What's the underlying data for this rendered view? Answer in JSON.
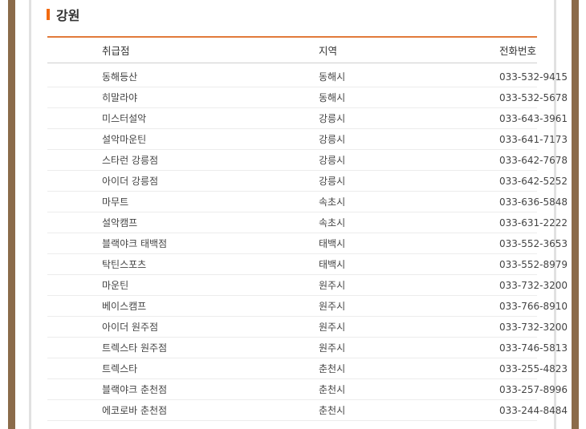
{
  "section": {
    "title": "강원"
  },
  "colors": {
    "accent": "#f26a10",
    "frame": "#8b6b4a"
  },
  "table": {
    "headers": {
      "store": "취급점",
      "region": "지역",
      "phone": "전화번호"
    },
    "rows": [
      {
        "store": "동해등산",
        "region": "동해시",
        "phone": "033-532-9415"
      },
      {
        "store": "히말라야",
        "region": "동해시",
        "phone": "033-532-5678"
      },
      {
        "store": "미스터설악",
        "region": "강릉시",
        "phone": "033-643-3961"
      },
      {
        "store": "설악마운틴",
        "region": "강릉시",
        "phone": "033-641-7173"
      },
      {
        "store": "스타런 강릉점",
        "region": "강릉시",
        "phone": "033-642-7678"
      },
      {
        "store": "아이더 강릉점",
        "region": "강릉시",
        "phone": "033-642-5252"
      },
      {
        "store": "마무트",
        "region": "속초시",
        "phone": "033-636-5848"
      },
      {
        "store": "설악캠프",
        "region": "속초시",
        "phone": "033-631-2222"
      },
      {
        "store": "블랙야크 태백점",
        "region": "태백시",
        "phone": "033-552-3653"
      },
      {
        "store": "탁틴스포츠",
        "region": "태백시",
        "phone": "033-552-8979"
      },
      {
        "store": "마운틴",
        "region": "원주시",
        "phone": "033-732-3200"
      },
      {
        "store": "베이스캠프",
        "region": "원주시",
        "phone": "033-766-8910"
      },
      {
        "store": "아이더 원주점",
        "region": "원주시",
        "phone": "033-732-3200"
      },
      {
        "store": "트렉스타 원주점",
        "region": "원주시",
        "phone": "033-746-5813"
      },
      {
        "store": "트렉스타",
        "region": "춘천시",
        "phone": "033-255-4823"
      },
      {
        "store": "블랙야크 춘천점",
        "region": "춘천시",
        "phone": "033-257-8996"
      },
      {
        "store": "에코로바 춘천점",
        "region": "춘천시",
        "phone": "033-244-8484"
      }
    ]
  }
}
